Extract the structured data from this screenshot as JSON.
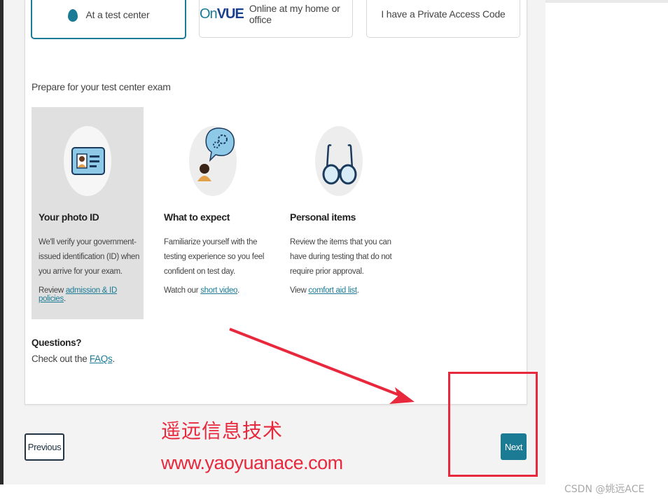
{
  "options": {
    "test_center_label": "At a test center",
    "onvue_logo_prefix": "On",
    "onvue_logo_suffix": "VUE",
    "online_label": "Online at my home or office",
    "private_code_label": "I have a Private Access Code"
  },
  "prepare": {
    "section_title": "Prepare for your test center exam",
    "tiles": [
      {
        "heading": "Your photo ID",
        "description": "We'll verify your government-issued identification (ID) when you arrive for your exam.",
        "link_prefix": "Review ",
        "link_text": "admission & ID policies",
        "link_suffix": ".",
        "icon": "id-card-icon"
      },
      {
        "heading": "What to expect",
        "description": "Familiarize yourself with the testing experience so you feel confident on test day.",
        "link_prefix": "Watch our ",
        "link_text": "short video",
        "link_suffix": ".",
        "icon": "person-thinking-icon"
      },
      {
        "heading": "Personal items",
        "description": "Review the items that you can have during testing that do not require prior approval.",
        "link_prefix": "View ",
        "link_text": "comfort aid list",
        "link_suffix": ".",
        "icon": "glasses-icon"
      }
    ]
  },
  "questions": {
    "title": "Questions?",
    "prefix": "Check out the ",
    "link_text": "FAQs",
    "suffix": "."
  },
  "nav": {
    "previous_label": "Previous",
    "next_label": "Next"
  },
  "watermark": {
    "chinese_text": "遥远信息技术",
    "url_text": "www.yaoyuanace.com",
    "csdn_text": "CSDN @姚远ACE"
  },
  "colors": {
    "accent": "#1b7a94",
    "annotation_red": "#e8283c"
  }
}
